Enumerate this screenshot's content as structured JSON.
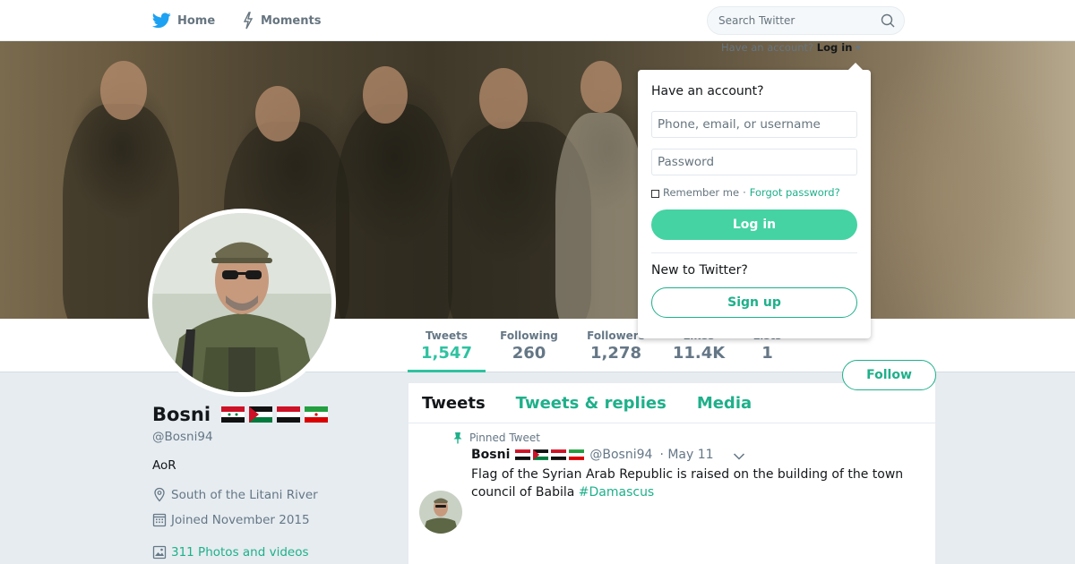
{
  "nav": {
    "home_label": "Home",
    "moments_label": "Moments",
    "search_placeholder": "Search Twitter"
  },
  "account_prompt": {
    "text": "Have an account?",
    "login_link": "Log in"
  },
  "login_panel": {
    "heading": "Have an account?",
    "username_placeholder": "Phone, email, or username",
    "password_placeholder": "Password",
    "remember_label": "Remember me",
    "separator": "·",
    "forgot_label": "Forgot password?",
    "login_button": "Log in",
    "new_heading": "New to Twitter?",
    "signup_button": "Sign up"
  },
  "stats": [
    {
      "label": "Tweets",
      "value": "1,547"
    },
    {
      "label": "Following",
      "value": "260"
    },
    {
      "label": "Followers",
      "value": "1,278"
    },
    {
      "label": "Likes",
      "value": "11.4K"
    },
    {
      "label": "Lists",
      "value": "1"
    }
  ],
  "follow_button": "Follow",
  "profile": {
    "name": "Bosni",
    "handle": "@Bosni94",
    "bio": "AoR",
    "location": "South of the Litani River",
    "joined": "Joined November 2015",
    "photos": "311 Photos and videos"
  },
  "timeline": {
    "tabs": [
      "Tweets",
      "Tweets & replies",
      "Media"
    ]
  },
  "tweet": {
    "pinned_label": "Pinned Tweet",
    "name": "Bosni",
    "handle": "@Bosni94",
    "date": "· May 11",
    "text": "Flag of the Syrian Arab Republic is raised on the building of the town council of Babila ",
    "hashtag": "#Damascus"
  },
  "colors": {
    "accent": "#1fb08a",
    "login_button": "#45d3a3",
    "brand_bird": "#1da1f2"
  },
  "icons": [
    "twitter-bird-icon",
    "lightning-icon",
    "search-icon",
    "caret-down-icon",
    "location-pin-icon",
    "calendar-icon",
    "photo-icon",
    "pin-icon",
    "chevron-down-icon"
  ]
}
